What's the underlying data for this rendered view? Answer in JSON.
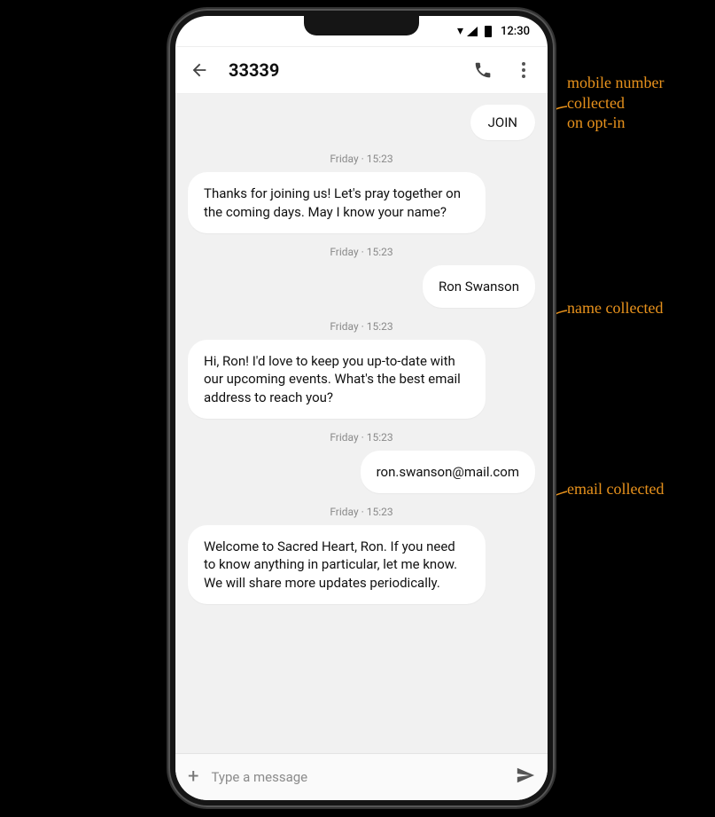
{
  "status": {
    "time": "12:30"
  },
  "header": {
    "title": "33339"
  },
  "messages": {
    "out1": "JOIN",
    "ts1": "Friday  ·  15:23",
    "in1": "Thanks for joining us! Let's pray together on the coming days. May I know your name?",
    "ts2": "Friday  ·  15:23",
    "out2": "Ron Swanson",
    "ts3": "Friday  ·  15:23",
    "in2": "Hi, Ron! I'd love to keep you up-to-date with our upcoming events. What's the best email address to reach you?",
    "ts4": "Friday  ·  15:23",
    "out3": "ron.swanson@mail.com",
    "ts5": "Friday  ·  15:23",
    "in3": "Welcome to Sacred Heart, Ron. If you need to know anything in particular, let me know. We will share more updates periodically."
  },
  "composer": {
    "placeholder": "Type a message"
  },
  "annotations": {
    "a1": "mobile number\ncollected\non opt-in",
    "a2": "name collected",
    "a3": "email collected"
  }
}
